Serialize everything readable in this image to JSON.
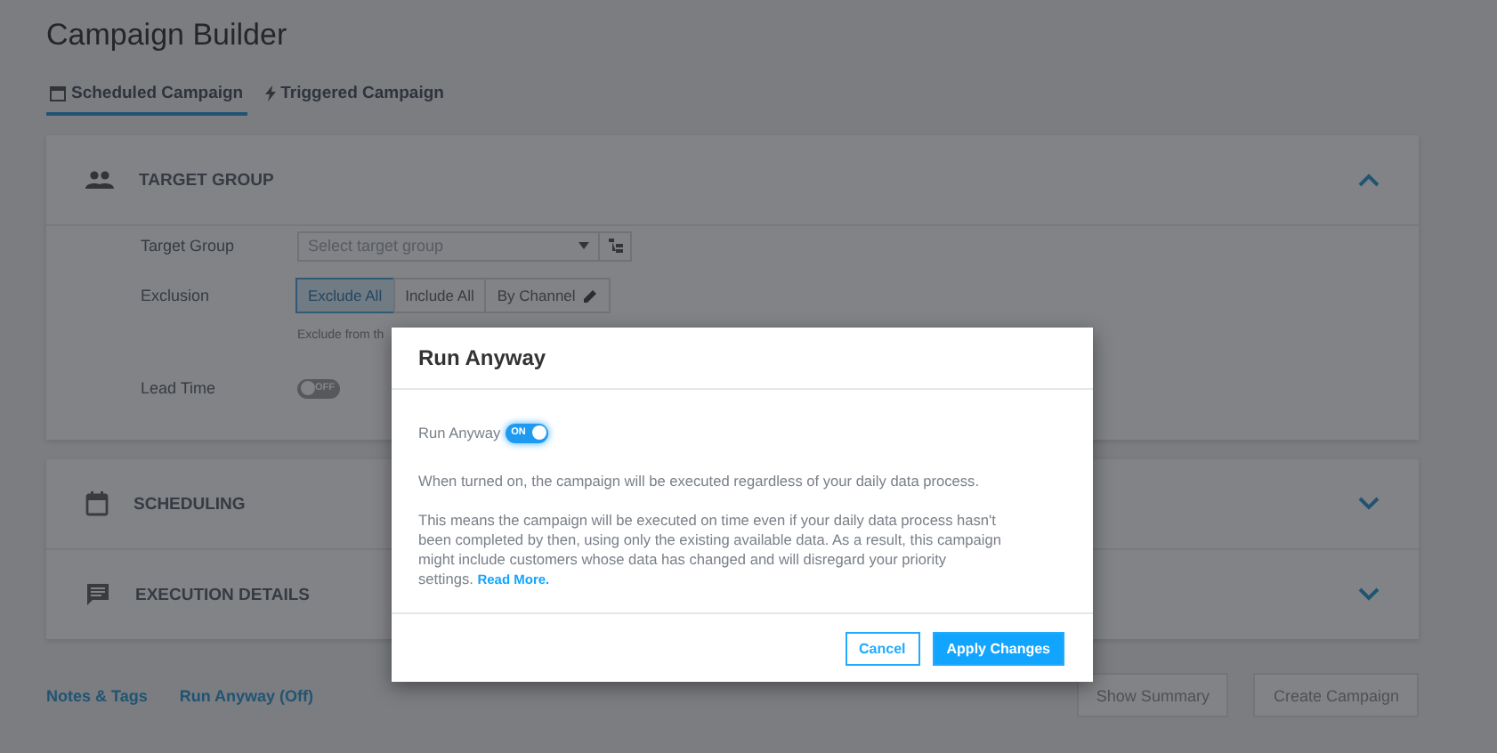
{
  "title": "Campaign Builder",
  "tabs": [
    {
      "label": "Scheduled Campaign",
      "kind": "calendar",
      "selected": true
    },
    {
      "label": "Triggered Campaign",
      "kind": "bolt",
      "selected": false
    }
  ],
  "target_group": {
    "title": "TARGET GROUP",
    "expanded": true,
    "target_label": "Target Group",
    "target_placeholder": "Select target group",
    "exclusion_label": "Exclusion",
    "exclusion_options": [
      {
        "label": "Exclude All",
        "selected": true
      },
      {
        "label": "Include All",
        "selected": false
      },
      {
        "label": "By Channel",
        "selected": false
      }
    ],
    "exclusion_hint": "Exclude from th",
    "lead_time_label": "Lead Time",
    "lead_time_toggle": {
      "on": false,
      "text": "OFF"
    }
  },
  "sections": [
    {
      "title": "SCHEDULING",
      "kind": "calendar",
      "expanded": false
    },
    {
      "title": "EXECUTION DETAILS",
      "kind": "chat",
      "expanded": false
    }
  ],
  "footer_links": [
    "Notes & Tags",
    "Run Anyway (Off)"
  ],
  "footer_buttons": [
    "Show Summary",
    "Create Campaign"
  ],
  "modal": {
    "title": "Run Anyway",
    "toggle_label": "Run Anyway",
    "toggle": {
      "on": true,
      "text": "ON"
    },
    "paragraphs": [
      "When turned on, the campaign will be executed regardless of your daily data process.",
      "This means the campaign will be executed on time even if your daily data process hasn't been completed by then, using only the existing available data. As a result, this campaign might include customers whose data has changed and will disregard your priority settings."
    ],
    "read_more": "Read More.",
    "buttons": [
      {
        "label": "Cancel",
        "kind": "secondary"
      },
      {
        "label": "Apply Changes",
        "kind": "primary"
      }
    ]
  }
}
